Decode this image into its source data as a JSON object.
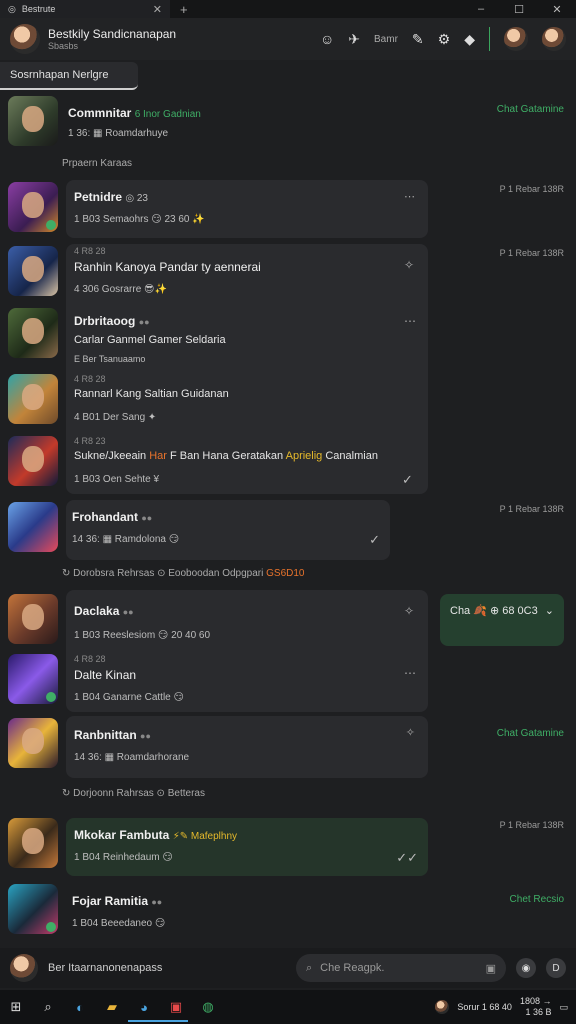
{
  "window": {
    "tab_title": "Bestrute",
    "new_tab": "+",
    "min": "–",
    "max": "☐",
    "close": "✕"
  },
  "header": {
    "title": "Bestkily Sandicnanapan",
    "subtitle": "Sbasbs",
    "action_label": "Bamr"
  },
  "section_tab": "Sosrnhapan Nerlgre",
  "messages": [
    {
      "name": "Commnitar",
      "tag": "6 Inor Gadnian",
      "meta": "1 36: ▦ Roamdarhuye",
      "status": "Chat Gatamine",
      "reply": "Prpaern Karaas"
    },
    {
      "name": "Petnidre",
      "tag": "◎ 23",
      "meta": "1 B03 Semaohrs 😏 23 60 ✨",
      "time": "P 1 Rebar 138R"
    },
    {
      "small": "4 R8 28",
      "name": "Ranhin Kanoya Pandar ty aennerai",
      "meta": "4 306 Gosrarre 😎✨",
      "time": "P 1 Rebar 138R"
    },
    {
      "name": "Drbritaoog",
      "tag": "●●",
      "text": "Carlar Ganmel Gamer Seldaria",
      "meta": "E Ber Tsanuaamo"
    },
    {
      "small": "4 R8 28",
      "text": "Rannarl Kang Saltian Guidanan",
      "meta": "4 B01 Der Sang ✦"
    },
    {
      "small": "4 R8 23",
      "text_a": "Sukne/Jkeeain",
      "text_b": "Har",
      "text_c": "F Ban Hana Geratakan",
      "text_d": "Aprielig",
      "text_e": "Canalmian",
      "meta": "1 B03 Oen Sehte ¥"
    },
    {
      "name": "Frohandant",
      "tag": "●●",
      "meta": "14 36: ▦ Ramdolona 😏",
      "time": "P 1 Rebar 138R"
    },
    {
      "reply_a": "Dorobsra Rehrsas",
      "reply_b": "Eooboodan Odpgpari",
      "reply_c": "GS6D10"
    },
    {
      "name": "Daclaka",
      "tag": "●●",
      "meta": "1 B03 Reeslesiom 😏 20 40 60",
      "chat": "Cha 🍂 ⊕ 68 0C3"
    },
    {
      "small": "4 R8 28",
      "text": "Dalte Kinan",
      "meta": "1 B04 Ganarne Cattle 😏"
    },
    {
      "name": "Ranbnittan",
      "tag": "●●",
      "meta": "14 36: ▦ Roamdarhorane",
      "status": "Chat Gatamine",
      "reply_a": "Dorjoonn Rahrsas",
      "reply_b": "Betteras"
    },
    {
      "name": "Mkokar Fambuta",
      "extra": "⚡✎ Mafeplhny",
      "meta": "1 B04 Reinhedaum 😏",
      "time": "P 1 Rebar 138R"
    },
    {
      "name": "Fojar Ramitia",
      "tag": "●●",
      "meta": "1 B04 Beeedaneo 😏",
      "status": "Chet Recsio"
    }
  ],
  "bottom": {
    "label": "Ber Itaarnanonenapass",
    "search_placeholder": "Che Reagpk."
  },
  "taskbar": {
    "tray_text": "Sorur 1 68 40",
    "clock_top": "1808 →",
    "clock_bottom": "1 36 B"
  },
  "colors": {
    "accent": "#3fae66",
    "highlight": "#e5b92b",
    "bubble": "#2a2b2e",
    "background": "#1e1f21"
  }
}
